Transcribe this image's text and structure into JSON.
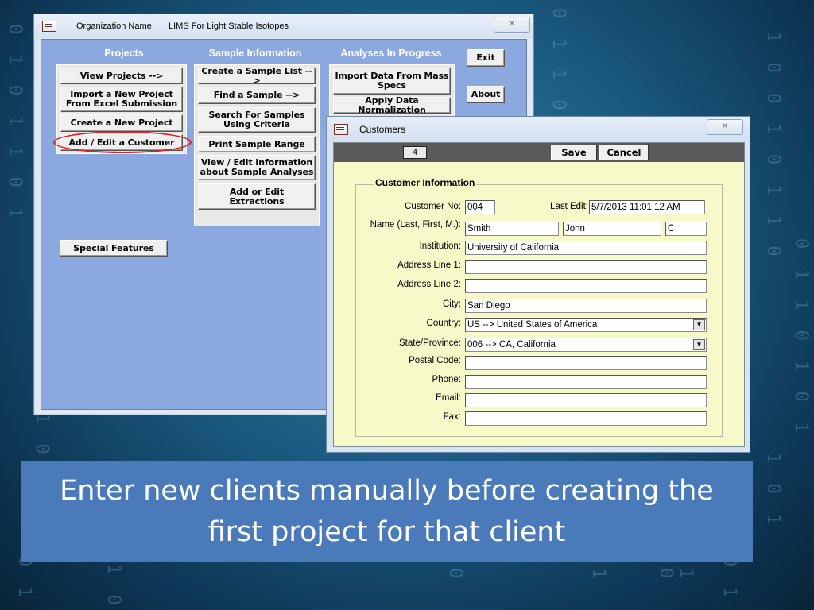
{
  "main_window": {
    "org_label": "Organization Name",
    "app_title": "LIMS For Light Stable Isotopes",
    "close_glyph": "✕",
    "columns": {
      "projects": {
        "heading": "Projects",
        "buttons": [
          "View Projects -->",
          "Import a New Project\nFrom Excel Submission",
          "Create a New Project",
          "Add / Edit a Customer"
        ]
      },
      "sample_information": {
        "heading": "Sample Information",
        "buttons": [
          "Create a Sample List -->",
          "Find a Sample -->",
          "Search For Samples\nUsing Criteria",
          "Print Sample Range",
          "View / Edit Information\nabout Sample Analyses",
          "Add or Edit\nExtractions"
        ]
      },
      "analyses_in_progress": {
        "heading": "Analyses In Progress",
        "buttons": [
          "Import Data From Mass\nSpecs",
          "Apply Data Normalization"
        ]
      }
    },
    "exit_label": "Exit",
    "about_label": "About",
    "special_features_label": "Special Features"
  },
  "customers_window": {
    "title": "Customers",
    "close_glyph": "✕",
    "record_number": "4",
    "save_label": "Save",
    "cancel_label": "Cancel",
    "section_title": "Customer Information",
    "fields": {
      "customer_no": {
        "label": "Customer No:",
        "value": "004"
      },
      "last_edit": {
        "label": "Last Edit:",
        "value": "5/7/2013 11:01:12 AM"
      },
      "name": {
        "label": "Name (Last, First, M.):",
        "last": "Smith",
        "first": "John",
        "middle": "C"
      },
      "institution": {
        "label": "Institution:",
        "value": "University of California"
      },
      "address1": {
        "label": "Address Line 1:",
        "value": ""
      },
      "address2": {
        "label": "Address Line 2:",
        "value": ""
      },
      "city": {
        "label": "City:",
        "value": "San Diego"
      },
      "country": {
        "label": "Country:",
        "value": "US --> United States of America"
      },
      "state": {
        "label": "State/Province:",
        "value": "006 --> CA, California"
      },
      "postal": {
        "label": "Postal Code:",
        "value": ""
      },
      "phone": {
        "label": "Phone:",
        "value": ""
      },
      "email": {
        "label": "Email:",
        "value": ""
      },
      "fax": {
        "label": "Fax:",
        "value": ""
      }
    }
  },
  "caption": {
    "line1": "Enter new clients manually before creating the",
    "line2": "first project for that client"
  },
  "colors": {
    "highlight": "#e02020",
    "form_background": "#f6f9c8",
    "main_panel": "#8ba8df",
    "caption_background": "#4a7ab9"
  }
}
